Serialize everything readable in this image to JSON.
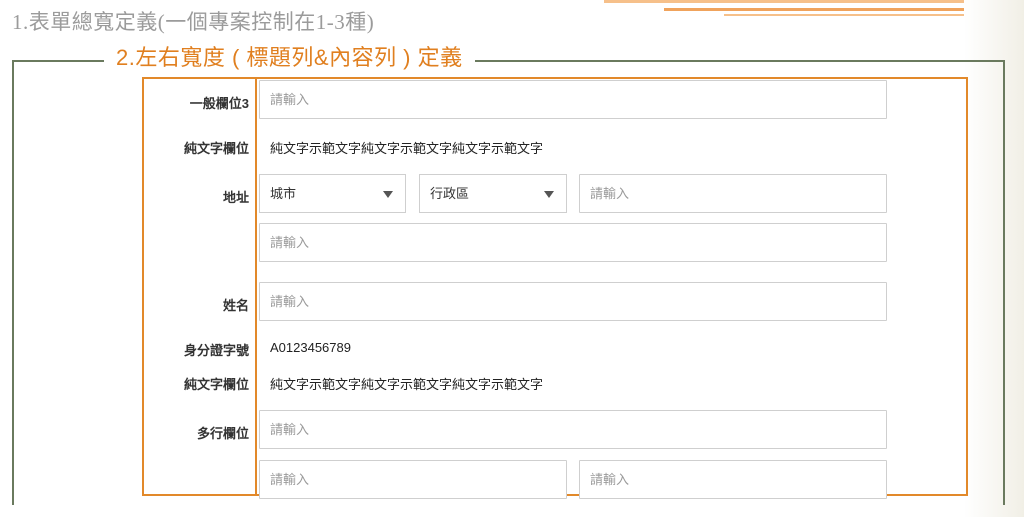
{
  "headings": {
    "section1": "1.表單總寬定義(一個專案控制在1-3種)",
    "section2": "2.左右寬度 ( 標題列&內容列 ) 定義"
  },
  "form": {
    "general_field": {
      "label": "一般欄位3",
      "placeholder": "請輸入"
    },
    "plain_text_1": {
      "label": "純文字欄位",
      "value": "純文字示範文字純文字示範文字純文字示範文字"
    },
    "address": {
      "label": "地址",
      "city": "城市",
      "district": "行政區",
      "detail_placeholder": "請輸入",
      "line2_placeholder": "請輸入"
    },
    "name": {
      "label": "姓名",
      "placeholder": "請輸入"
    },
    "id_number": {
      "label": "身分證字號",
      "value": "A0123456789"
    },
    "plain_text_2": {
      "label": "純文字欄位",
      "value": "純文字示範文字純文字示範文字純文字示範文字"
    },
    "multi_field": {
      "label": "多行欄位",
      "placeholder_1": "請輸入",
      "placeholder_2": "請輸入",
      "placeholder_3": "請輸入"
    }
  },
  "colors": {
    "accent_orange": "#e2892a",
    "frame_green": "#6a7a5e",
    "muted_heading": "#9b9b9b"
  },
  "icons": {
    "dropdown": "chevron-down-icon"
  }
}
